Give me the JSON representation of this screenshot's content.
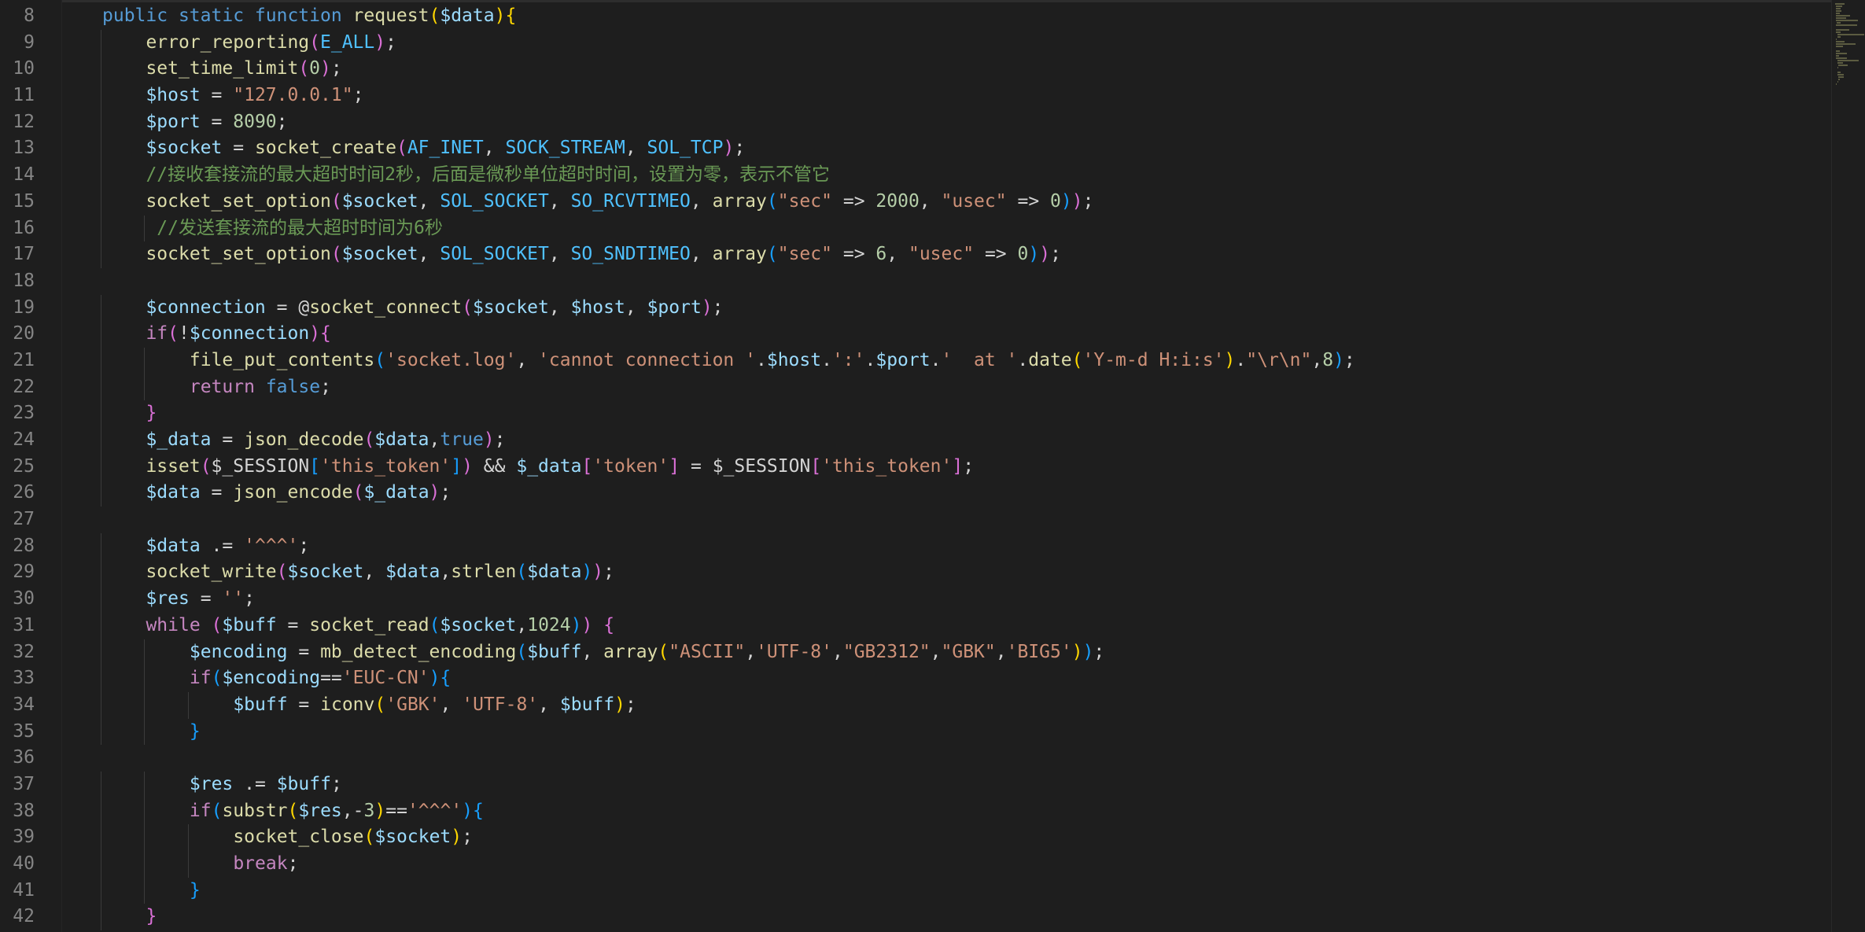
{
  "editor": {
    "lines": [
      {
        "n": "8",
        "code": "public static function request($data){"
      },
      {
        "n": "9",
        "code": "    error_reporting(E_ALL);"
      },
      {
        "n": "10",
        "code": "    set_time_limit(0);"
      },
      {
        "n": "11",
        "code": "    $host = \"127.0.0.1\";"
      },
      {
        "n": "12",
        "code": "    $port = 8090;"
      },
      {
        "n": "13",
        "code": "    $socket = socket_create(AF_INET, SOCK_STREAM, SOL_TCP);"
      },
      {
        "n": "14",
        "code": "    //接收套接流的最大超时时间2秒，后面是微秒单位超时时间，设置为零，表示不管它"
      },
      {
        "n": "15",
        "code": "    socket_set_option($socket, SOL_SOCKET, SO_RCVTIMEO, array(\"sec\" => 2000, \"usec\" => 0));"
      },
      {
        "n": "16",
        "code": "     //发送套接流的最大超时时间为6秒"
      },
      {
        "n": "17",
        "code": "    socket_set_option($socket, SOL_SOCKET, SO_SNDTIMEO, array(\"sec\" => 6, \"usec\" => 0));"
      },
      {
        "n": "18",
        "code": ""
      },
      {
        "n": "19",
        "code": "    $connection = @socket_connect($socket, $host, $port);"
      },
      {
        "n": "20",
        "code": "    if(!$connection){"
      },
      {
        "n": "21",
        "code": "        file_put_contents('socket.log', 'cannot connection '.$host.':'.$port.'  at '.date('Y-m-d H:i:s').\"\\r\\n\",8);"
      },
      {
        "n": "22",
        "code": "        return false;"
      },
      {
        "n": "23",
        "code": "    }"
      },
      {
        "n": "24",
        "code": "    $_data = json_decode($data,true);"
      },
      {
        "n": "25",
        "code": "    isset($_SESSION['this_token']) && $_data['token'] = $_SESSION['this_token'];"
      },
      {
        "n": "26",
        "code": "    $data = json_encode($_data);"
      },
      {
        "n": "27",
        "code": ""
      },
      {
        "n": "28",
        "code": "    $data .= '^^^';"
      },
      {
        "n": "29",
        "code": "    socket_write($socket, $data,strlen($data));"
      },
      {
        "n": "30",
        "code": "    $res = '';"
      },
      {
        "n": "31",
        "code": "    while ($buff = socket_read($socket,1024)) {"
      },
      {
        "n": "32",
        "code": "        $encoding = mb_detect_encoding($buff, array(\"ASCII\",'UTF-8',\"GB2312\",\"GBK\",'BIG5'));"
      },
      {
        "n": "33",
        "code": "        if($encoding=='EUC-CN'){"
      },
      {
        "n": "34",
        "code": "            $buff = iconv('GBK', 'UTF-8', $buff);"
      },
      {
        "n": "35",
        "code": "        }"
      },
      {
        "n": "36",
        "code": ""
      },
      {
        "n": "37",
        "code": "        $res .= $buff;"
      },
      {
        "n": "38",
        "code": "        if(substr($res,-3)=='^^^'){"
      },
      {
        "n": "39",
        "code": "            socket_close($socket);"
      },
      {
        "n": "40",
        "code": "            break;"
      },
      {
        "n": "41",
        "code": "        }"
      },
      {
        "n": "42",
        "code": "    }"
      }
    ]
  },
  "colors": {
    "background": "#1e1e1e",
    "line_number": "#858585",
    "keyword": "#c586c0",
    "storage": "#569cd6",
    "function": "#dcdcaa",
    "variable": "#9cdcfe",
    "string": "#ce9178",
    "number": "#b5cea8",
    "comment": "#6a9955",
    "constant": "#4fc1ff"
  }
}
